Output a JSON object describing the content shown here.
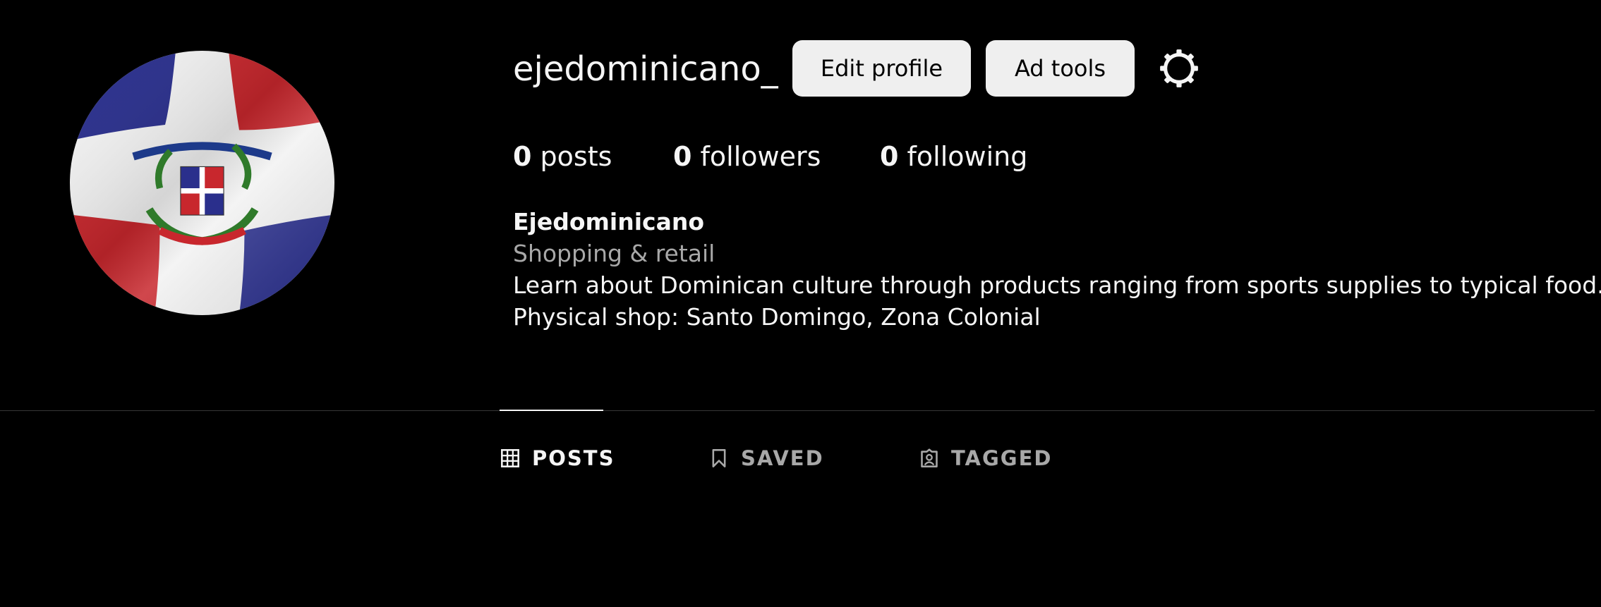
{
  "profile": {
    "username": "ejedominicano_",
    "avatar_icon": "dominican-flag-avatar",
    "edit_profile_label": "Edit profile",
    "ad_tools_label": "Ad tools",
    "settings_icon": "gear-icon"
  },
  "stats": {
    "posts_count": "0",
    "posts_label": "posts",
    "followers_count": "0",
    "followers_label": "followers",
    "following_count": "0",
    "following_label": "following"
  },
  "bio": {
    "name": "Ejedominicano",
    "category": "Shopping & retail",
    "lines": [
      "Learn about Dominican culture through products ranging from sports supplies to typical food.",
      "Physical shop: Santo Domingo, Zona Colonial"
    ]
  },
  "tabs": [
    {
      "label": "POSTS",
      "icon": "grid-icon",
      "active": true
    },
    {
      "label": "SAVED",
      "icon": "bookmark-icon",
      "active": false
    },
    {
      "label": "TAGGED",
      "icon": "tagged-icon",
      "active": false
    }
  ],
  "colors": {
    "background": "#000000",
    "text_primary": "#f5f5f5",
    "text_secondary": "#a8a8a8",
    "button_bg": "#efefef",
    "divider": "#363636",
    "flag_blue": "#002d62",
    "flag_red": "#ce1126"
  }
}
